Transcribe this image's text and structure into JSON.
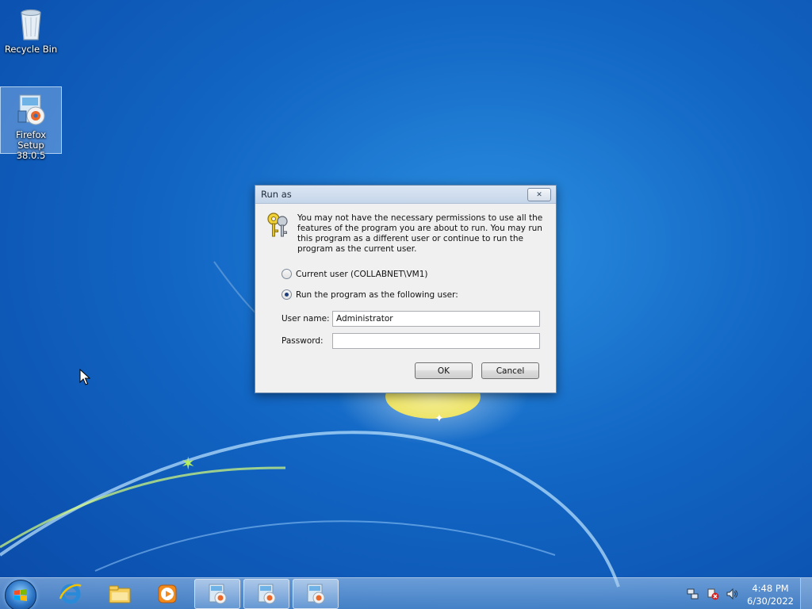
{
  "desktop": {
    "icons": [
      {
        "label": "Recycle Bin"
      },
      {
        "label": "Firefox Setup 38.0.5"
      }
    ]
  },
  "dialog": {
    "title": "Run as",
    "close_glyph": "✕",
    "message": "You may not have the necessary permissions to use all the features of the program you are about to run. You may run this program as a different user or continue to run the program as the current user.",
    "option_current_user": "Current user (COLLABNET\\VM1)",
    "option_other_user": "Run the program as the following user:",
    "selected_option": "other_user",
    "username_label": "User name:",
    "username_value": "Administrator",
    "password_label": "Password:",
    "password_value": "",
    "ok_label": "OK",
    "cancel_label": "Cancel",
    "icon": "keys-icon"
  },
  "taskbar": {
    "pinned": [
      "windows-start-orb-icon",
      "internet-explorer-icon",
      "windows-explorer-icon",
      "media-player-icon"
    ],
    "open_windows": [
      "firefox-setup-icon",
      "firefox-setup-icon",
      "firefox-setup-icon"
    ],
    "tray_icons": [
      "network-icon",
      "action-center-icon",
      "volume-icon"
    ],
    "time": "4:48 PM",
    "date": "6/30/2022"
  }
}
